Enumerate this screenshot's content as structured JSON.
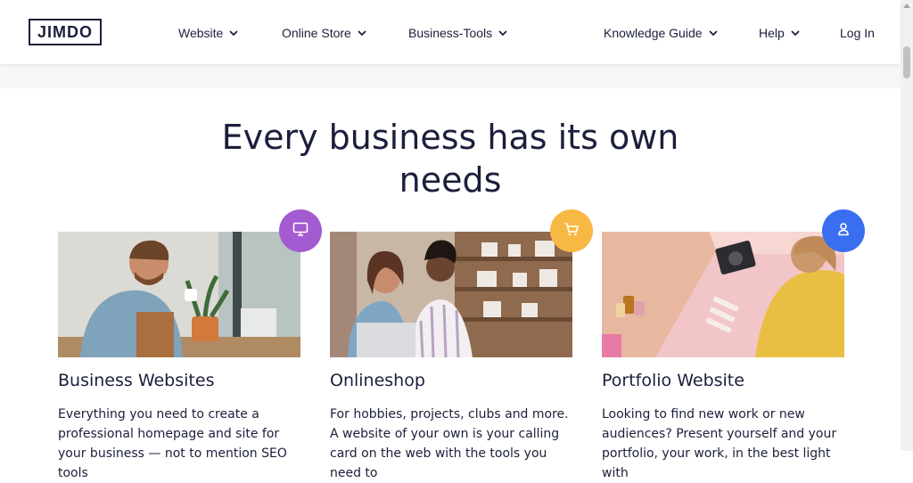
{
  "header": {
    "logo": "JIMDO",
    "nav": [
      {
        "label": "Website"
      },
      {
        "label": "Online Store"
      },
      {
        "label": "Business-Tools"
      },
      {
        "label": "Knowledge Guide"
      },
      {
        "label": "Help"
      }
    ],
    "login": "Log In"
  },
  "main": {
    "headline": "Every business has its own needs",
    "cards": [
      {
        "title": "Business Websites",
        "text": "Everything you need to create a professional homepage and site for your business — not to mention SEO tools",
        "badge_icon": "monitor-icon",
        "badge_color": "#a45ad1"
      },
      {
        "title": "Onlineshop",
        "text": "For hobbies, projects, clubs and more. A website of your own is your calling card on the web with the tools you need to",
        "badge_icon": "cart-icon",
        "badge_color": "#f7b844"
      },
      {
        "title": "Portfolio Website",
        "text": "Looking to find new work or new audiences? Present yourself and your portfolio, your work, in the best light with",
        "badge_icon": "person-icon",
        "badge_color": "#3a6ef0"
      }
    ]
  }
}
